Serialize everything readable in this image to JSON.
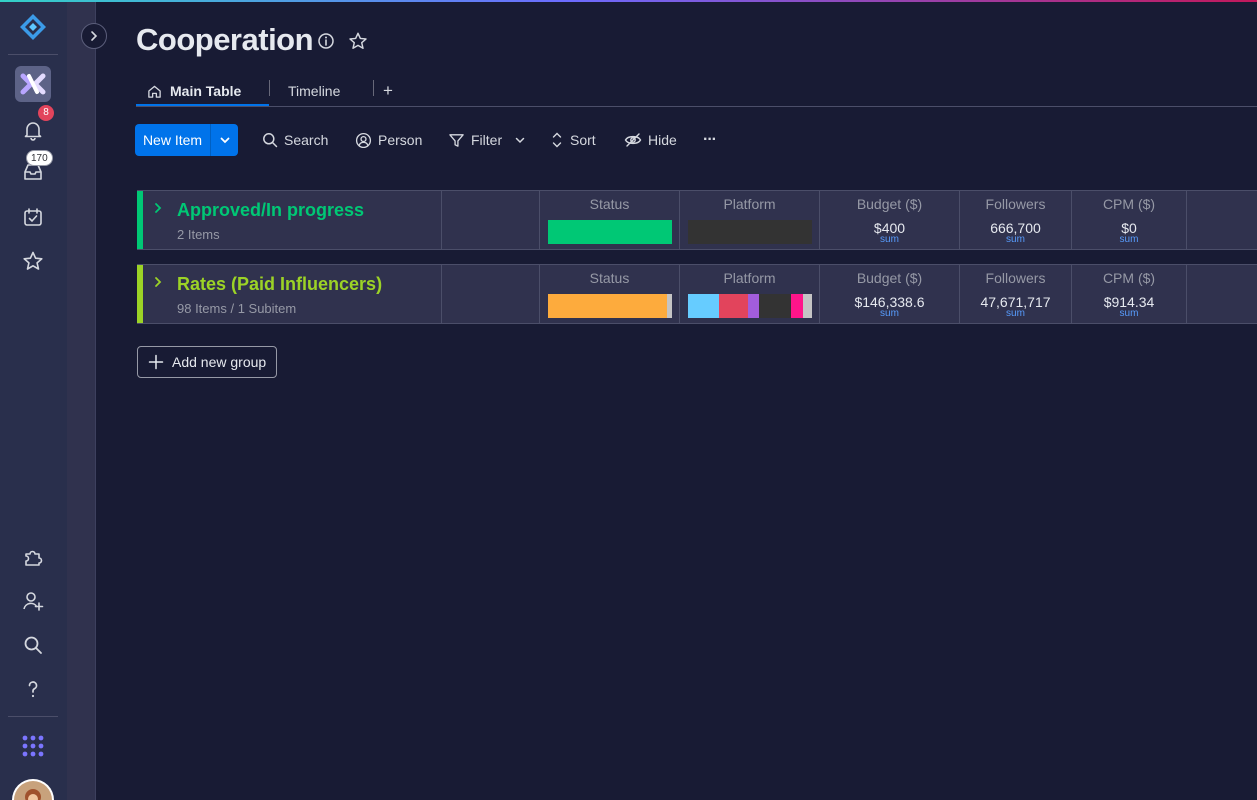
{
  "board": {
    "title": "Cooperation",
    "tabs": [
      {
        "label": "Main Table",
        "active": true
      },
      {
        "label": "Timeline",
        "active": false
      }
    ],
    "add_tab_label": "+"
  },
  "rail": {
    "notifications_badge": "8",
    "inbox_badge": "170"
  },
  "toolbar": {
    "new_item_label": "New Item",
    "search_label": "Search",
    "person_label": "Person",
    "filter_label": "Filter",
    "sort_label": "Sort",
    "hide_label": "Hide",
    "more_label": "···"
  },
  "columns": {
    "status": "Status",
    "platform": "Platform",
    "budget": "Budget ($)",
    "followers": "Followers",
    "cpm": "CPM ($)"
  },
  "sum_label": "sum",
  "groups": [
    {
      "name": "Approved/In progress",
      "count": "2 Items",
      "color": "#00c875",
      "budget": "$400",
      "followers": "666,700",
      "cpm": "$0",
      "status_segments": [
        {
          "color": "#00c875",
          "fraction": 1.0
        }
      ],
      "platform_segments": [
        {
          "color": "#333333",
          "fraction": 1.0
        }
      ]
    },
    {
      "name": "Rates (Paid Influencers)",
      "count": "98 Items / 1 Subitem",
      "color": "#9cd326",
      "budget": "$146,338.6",
      "followers": "47,671,717",
      "cpm": "$914.34",
      "status_segments": [
        {
          "color": "#fdab3d",
          "fraction": 0.96
        },
        {
          "color": "#c4c4c4",
          "fraction": 0.04
        }
      ],
      "platform_segments": [
        {
          "color": "#66ccff",
          "fraction": 0.25
        },
        {
          "color": "#e2445c",
          "fraction": 0.23
        },
        {
          "color": "#a25ddc",
          "fraction": 0.09
        },
        {
          "color": "#333333",
          "fraction": 0.26
        },
        {
          "color": "#ff158a",
          "fraction": 0.1
        },
        {
          "color": "#c4c4c4",
          "fraction": 0.07
        }
      ]
    }
  ],
  "add_group_label": "Add new group",
  "colors": {
    "accent": "#0073ea",
    "background": "#181b34",
    "surface": "#30324e"
  }
}
